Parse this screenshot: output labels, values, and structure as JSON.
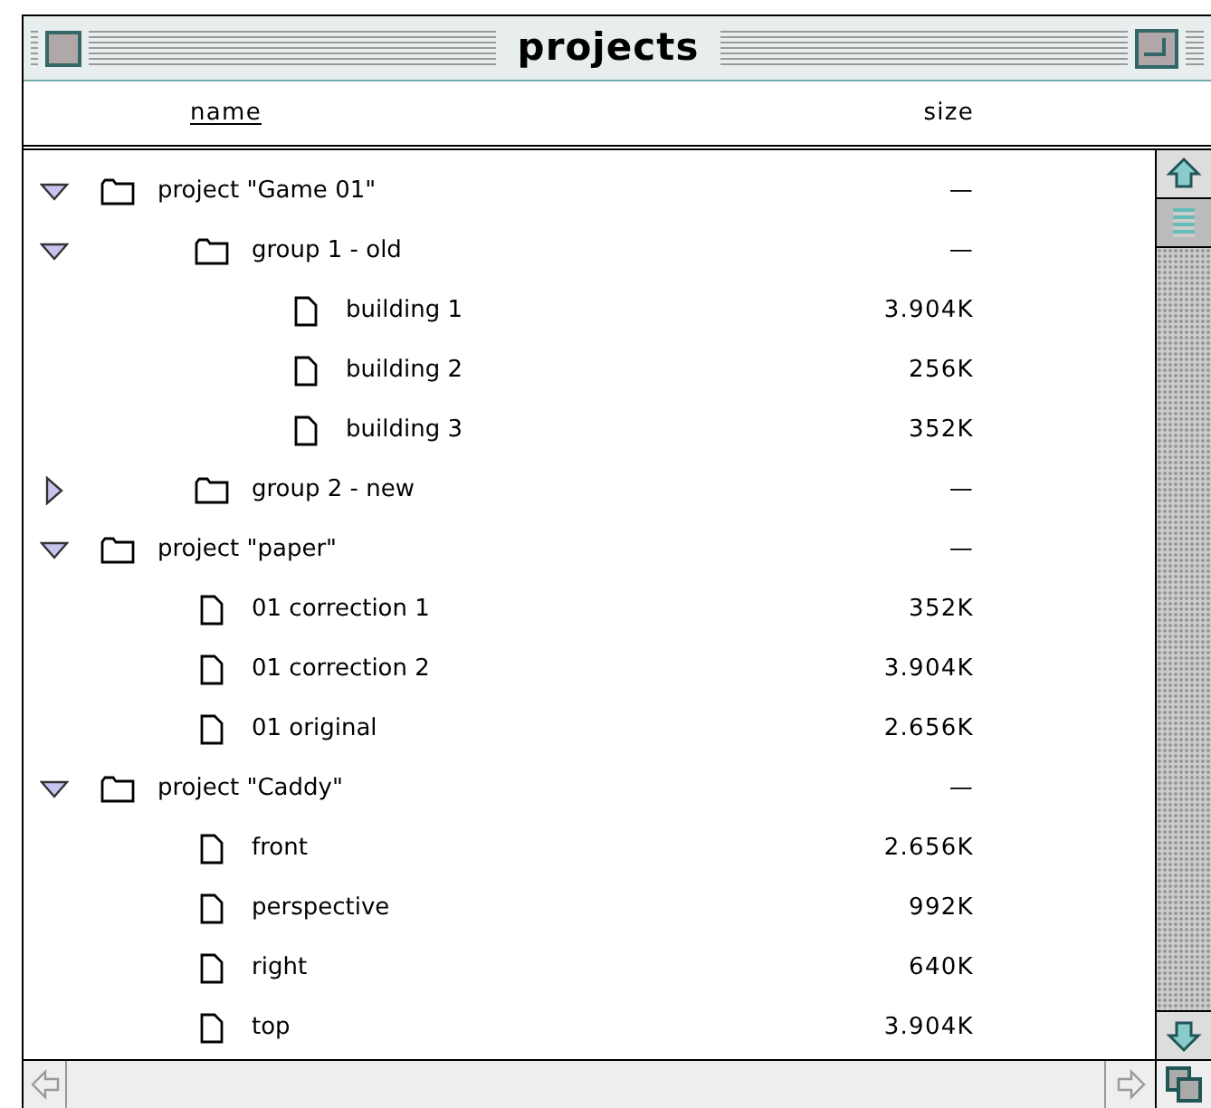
{
  "window": {
    "title": "projects"
  },
  "columns": [
    {
      "label": "name",
      "sorted": true
    },
    {
      "label": "size",
      "sorted": false
    }
  ],
  "items": [
    {
      "kind": "folder",
      "name": "project \"Game 01\"",
      "size": "—",
      "expanded": true,
      "children": [
        {
          "kind": "folder",
          "name": "group 1 - old",
          "size": "—",
          "expanded": true,
          "children": [
            {
              "kind": "file",
              "name": "building 1",
              "size": "3.904K"
            },
            {
              "kind": "file",
              "name": "building 2",
              "size": "256K"
            },
            {
              "kind": "file",
              "name": "building 3",
              "size": "352K"
            }
          ]
        },
        {
          "kind": "folder",
          "name": "group 2 - new",
          "size": "—",
          "expanded": false
        }
      ]
    },
    {
      "kind": "folder",
      "name": "project \"paper\"",
      "size": "—",
      "expanded": true,
      "children": [
        {
          "kind": "file",
          "name": "01 correction 1",
          "size": "352K"
        },
        {
          "kind": "file",
          "name": "01 correction 2",
          "size": "3.904K"
        },
        {
          "kind": "file",
          "name": "01 original",
          "size": "2.656K"
        }
      ]
    },
    {
      "kind": "folder",
      "name": "project \"Caddy\"",
      "size": "—",
      "expanded": true,
      "children": [
        {
          "kind": "file",
          "name": "front",
          "size": "2.656K"
        },
        {
          "kind": "file",
          "name": "perspective",
          "size": "992K"
        },
        {
          "kind": "file",
          "name": "right",
          "size": "640K"
        },
        {
          "kind": "file",
          "name": "top",
          "size": "3.904K"
        }
      ]
    }
  ]
}
